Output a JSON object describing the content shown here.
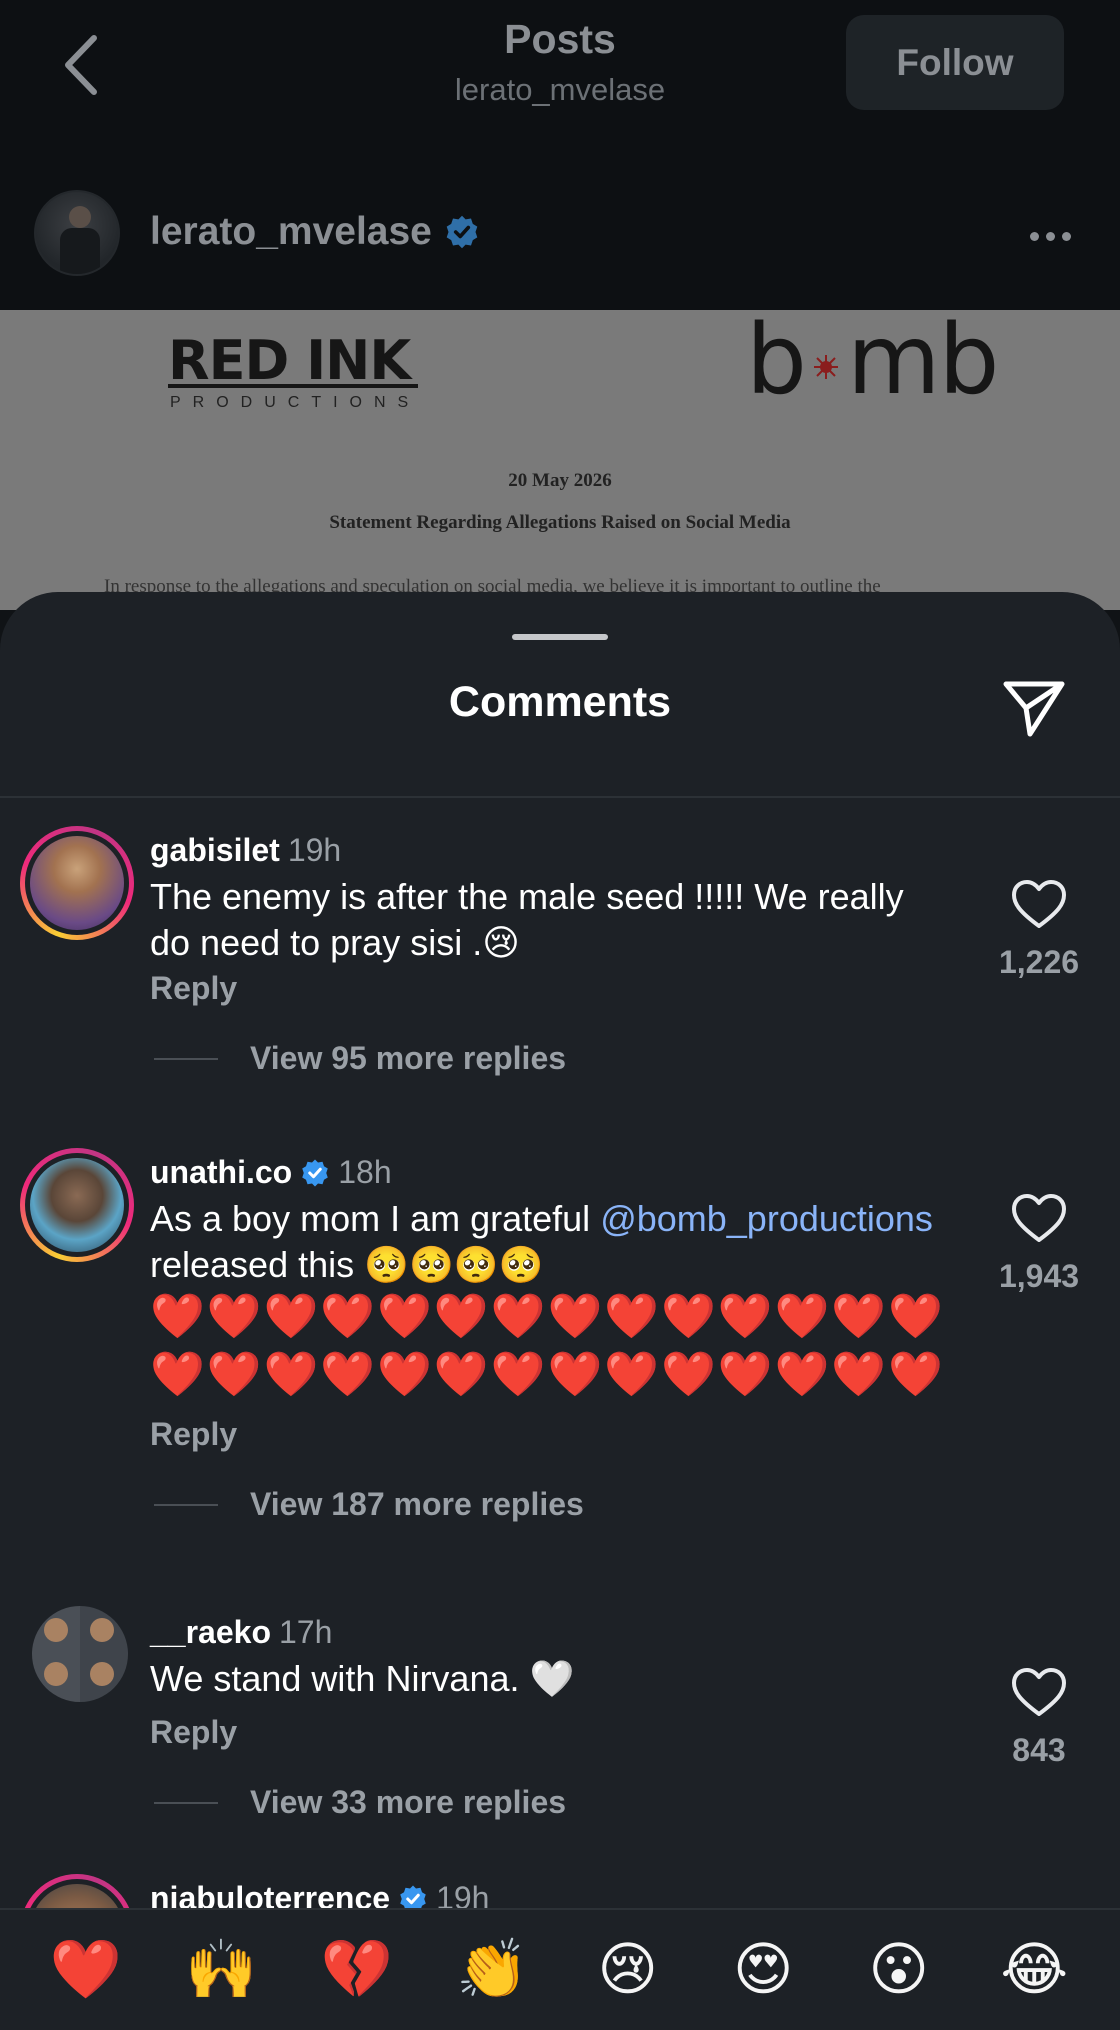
{
  "header": {
    "title": "Posts",
    "subtitle": "lerato_mvelase",
    "follow_label": "Follow"
  },
  "post": {
    "username": "lerato_mvelase",
    "verified": true,
    "document": {
      "logo_left_main": "RED INK",
      "logo_left_sub": "PRODUCTIONS",
      "logo_right_start": "b",
      "logo_right_end": "mb",
      "date": "20 May 2026",
      "heading": "Statement Regarding Allegations Raised on Social Media",
      "body_line": "In response to the allegations and speculation on social media, we believe it is important to outline the"
    }
  },
  "sheet": {
    "title": "Comments"
  },
  "comments": [
    {
      "username": "gabisilet",
      "verified": false,
      "time": "19h",
      "text": "The enemy is after the male seed !!!!! We really do need to pray sisi .😢",
      "reply_label": "Reply",
      "view_replies": "View 95 more replies",
      "likes": "1,226"
    },
    {
      "username": "unathi.co",
      "verified": true,
      "time": "18h",
      "text_before": "As a boy mom I am grateful ",
      "mention": "@bomb_productions",
      "text_after": " released this 🥺🥺🥺🥺",
      "hearts": "❤️❤️❤️❤️❤️❤️❤️❤️❤️❤️❤️❤️❤️❤️❤️❤️❤️❤️❤️❤️❤️❤️❤️❤️❤️❤️❤️❤️",
      "reply_label": "Reply",
      "view_replies": "View 187 more replies",
      "likes": "1,943"
    },
    {
      "username": "__raeko",
      "verified": false,
      "time": "17h",
      "text": "We stand with Nirvana. 🤍",
      "reply_label": "Reply",
      "view_replies": "View 33 more replies",
      "likes": "843"
    },
    {
      "username": "njabuloterrence",
      "verified": true,
      "time": "19h"
    }
  ],
  "reactions": [
    "❤️",
    "🙌",
    "💔",
    "👏",
    "😢",
    "😍",
    "😮",
    "😂"
  ],
  "colors": {
    "sheet_bg": "#1d2126",
    "mention": "#8ab4f8",
    "verified": "#3897f0",
    "muted_text": "#9aa0a6"
  },
  "icons": [
    "back-chevron-icon",
    "verified-badge-icon",
    "more-dots-icon",
    "share-send-icon",
    "heart-outline-icon"
  ]
}
